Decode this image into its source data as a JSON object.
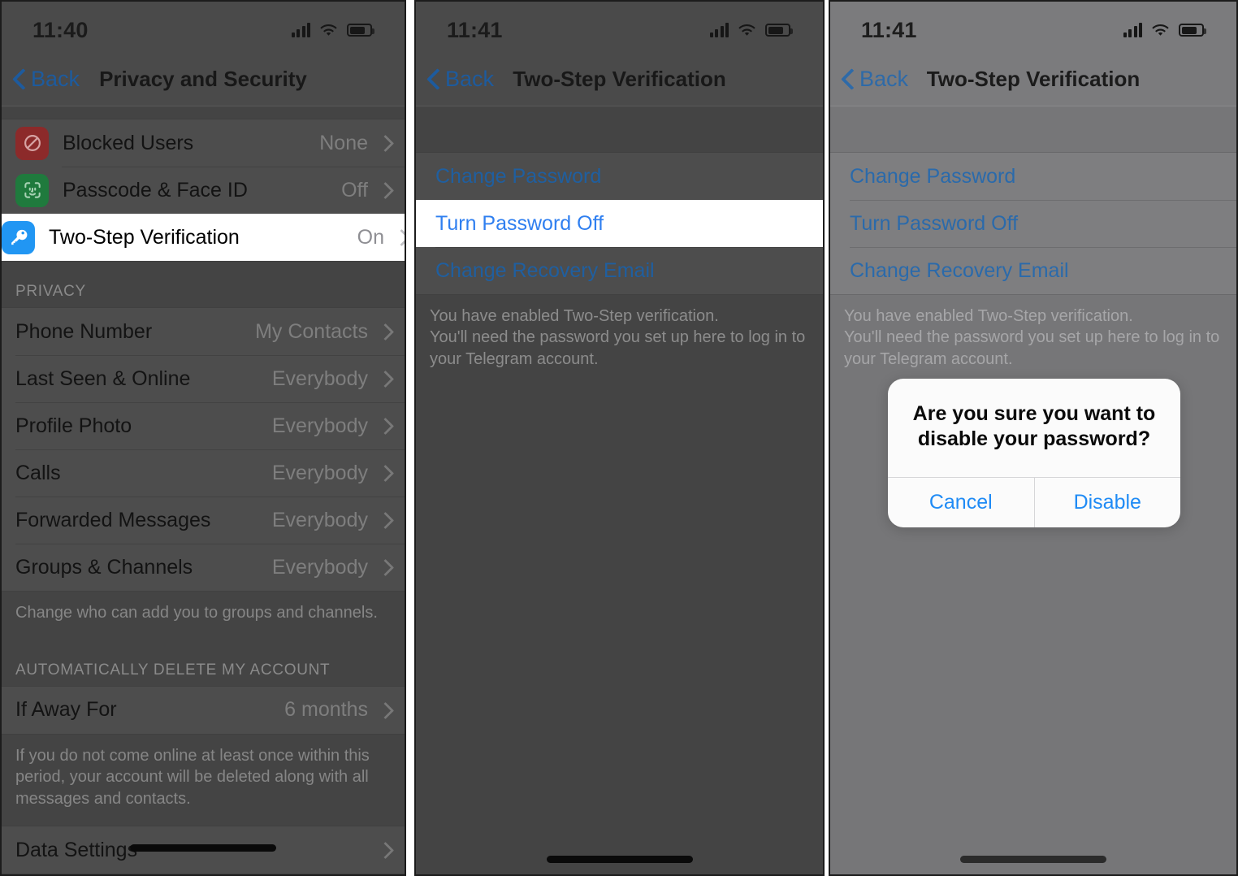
{
  "panels": [
    {
      "id": "privacy-and-security",
      "status": {
        "time": "11:40",
        "signal_icon": "cellular-bars-icon",
        "wifi_icon": "wifi-icon",
        "battery_icon": "battery-icon"
      },
      "nav": {
        "back_label": "Back",
        "back_icon": "chevron-left-icon",
        "title": "Privacy and Security"
      },
      "security_rows": [
        {
          "icon": "blocked-users-icon",
          "icon_color": "#8c2a2a",
          "label": "Blocked Users",
          "value": "None",
          "chevron": "chevron-right-icon",
          "highlighted": false
        },
        {
          "icon": "face-id-icon",
          "icon_color": "#1f7a3d",
          "label": "Passcode & Face ID",
          "value": "Off",
          "chevron": "chevron-right-icon",
          "highlighted": false
        },
        {
          "icon": "key-icon",
          "icon_color": "#2196f3",
          "label": "Two-Step Verification",
          "value": "On",
          "chevron": "chevron-right-icon",
          "highlighted": true
        }
      ],
      "privacy_header": "PRIVACY",
      "privacy_rows": [
        {
          "label": "Phone Number",
          "value": "My Contacts",
          "chevron": "chevron-right-icon"
        },
        {
          "label": "Last Seen & Online",
          "value": "Everybody",
          "chevron": "chevron-right-icon"
        },
        {
          "label": "Profile Photo",
          "value": "Everybody",
          "chevron": "chevron-right-icon"
        },
        {
          "label": "Calls",
          "value": "Everybody",
          "chevron": "chevron-right-icon"
        },
        {
          "label": "Forwarded Messages",
          "value": "Everybody",
          "chevron": "chevron-right-icon"
        },
        {
          "label": "Groups & Channels",
          "value": "Everybody",
          "chevron": "chevron-right-icon"
        }
      ],
      "privacy_footnote": "Change who can add you to groups and channels.",
      "delete_header": "AUTOMATICALLY DELETE MY ACCOUNT",
      "delete_rows": [
        {
          "label": "If Away For",
          "value": "6 months",
          "chevron": "chevron-right-icon"
        }
      ],
      "delete_footnote": "If you do not come online at least once within this period, your account will be deleted along with all messages and contacts.",
      "data_rows": [
        {
          "label": "Data Settings",
          "value": "",
          "chevron": "chevron-right-icon"
        }
      ]
    },
    {
      "id": "two-step-verification-highlight",
      "status": {
        "time": "11:41",
        "signal_icon": "cellular-bars-icon",
        "wifi_icon": "wifi-icon",
        "battery_icon": "battery-icon"
      },
      "nav": {
        "back_label": "Back",
        "back_icon": "chevron-left-icon",
        "title": "Two-Step Verification"
      },
      "links": [
        {
          "label": "Change Password",
          "highlighted": false
        },
        {
          "label": "Turn Password Off",
          "highlighted": true
        },
        {
          "label": "Change Recovery Email",
          "highlighted": false
        }
      ],
      "footnote": "You have enabled Two-Step verification.\nYou'll need the password you set up here to log in to your Telegram account."
    },
    {
      "id": "two-step-verification-alert",
      "status": {
        "time": "11:41",
        "signal_icon": "cellular-bars-icon",
        "wifi_icon": "wifi-icon",
        "battery_icon": "battery-icon"
      },
      "nav": {
        "back_label": "Back",
        "back_icon": "chevron-left-icon",
        "title": "Two-Step Verification"
      },
      "links": [
        {
          "label": "Change Password",
          "highlighted": false
        },
        {
          "label": "Turn Password Off",
          "highlighted": false
        },
        {
          "label": "Change Recovery Email",
          "highlighted": false
        }
      ],
      "footnote": "You have enabled Two-Step verification.\nYou'll need the password you set up here to log in to your Telegram account.",
      "alert": {
        "title": "Are you sure you want to disable your password?",
        "cancel_label": "Cancel",
        "confirm_label": "Disable"
      }
    }
  ],
  "colors": {
    "accent_blue": "#2f7ff0",
    "link_blue": "#1f8bf5",
    "key_icon_blue": "#2196f3",
    "blocked_red": "#8c2a2a",
    "faceid_green": "#1f7a3d",
    "highlight_white": "#ffffff"
  }
}
